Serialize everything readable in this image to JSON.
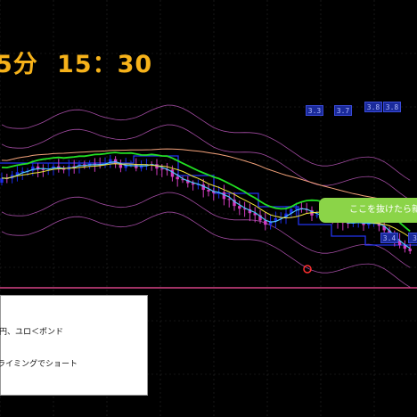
{
  "chart_data": {
    "type": "candlestick",
    "title_timeframe": "5分",
    "title_time": "15：30",
    "note_lines": [
      "円、ユロ＜ポンド",
      "ライミングでショート"
    ],
    "callout": "ここを抜けたら新",
    "level_badges": [
      "3.3",
      "3.7",
      "3.8",
      "3.8",
      "3.4",
      "3."
    ],
    "colors": {
      "up": "#1b2be8",
      "down": "#d23cc0",
      "ma_fast": "#4fc8ff",
      "ma_mid": "#f2e63a",
      "ma_green": "#22e022",
      "ma_orange": "#f3a27a",
      "bands": "#a04aa0",
      "step_blue": "#2233ee",
      "hline": "#ff4fa0",
      "callout": "#8bd448",
      "title": "#f6b21a"
    },
    "grid": true
  }
}
